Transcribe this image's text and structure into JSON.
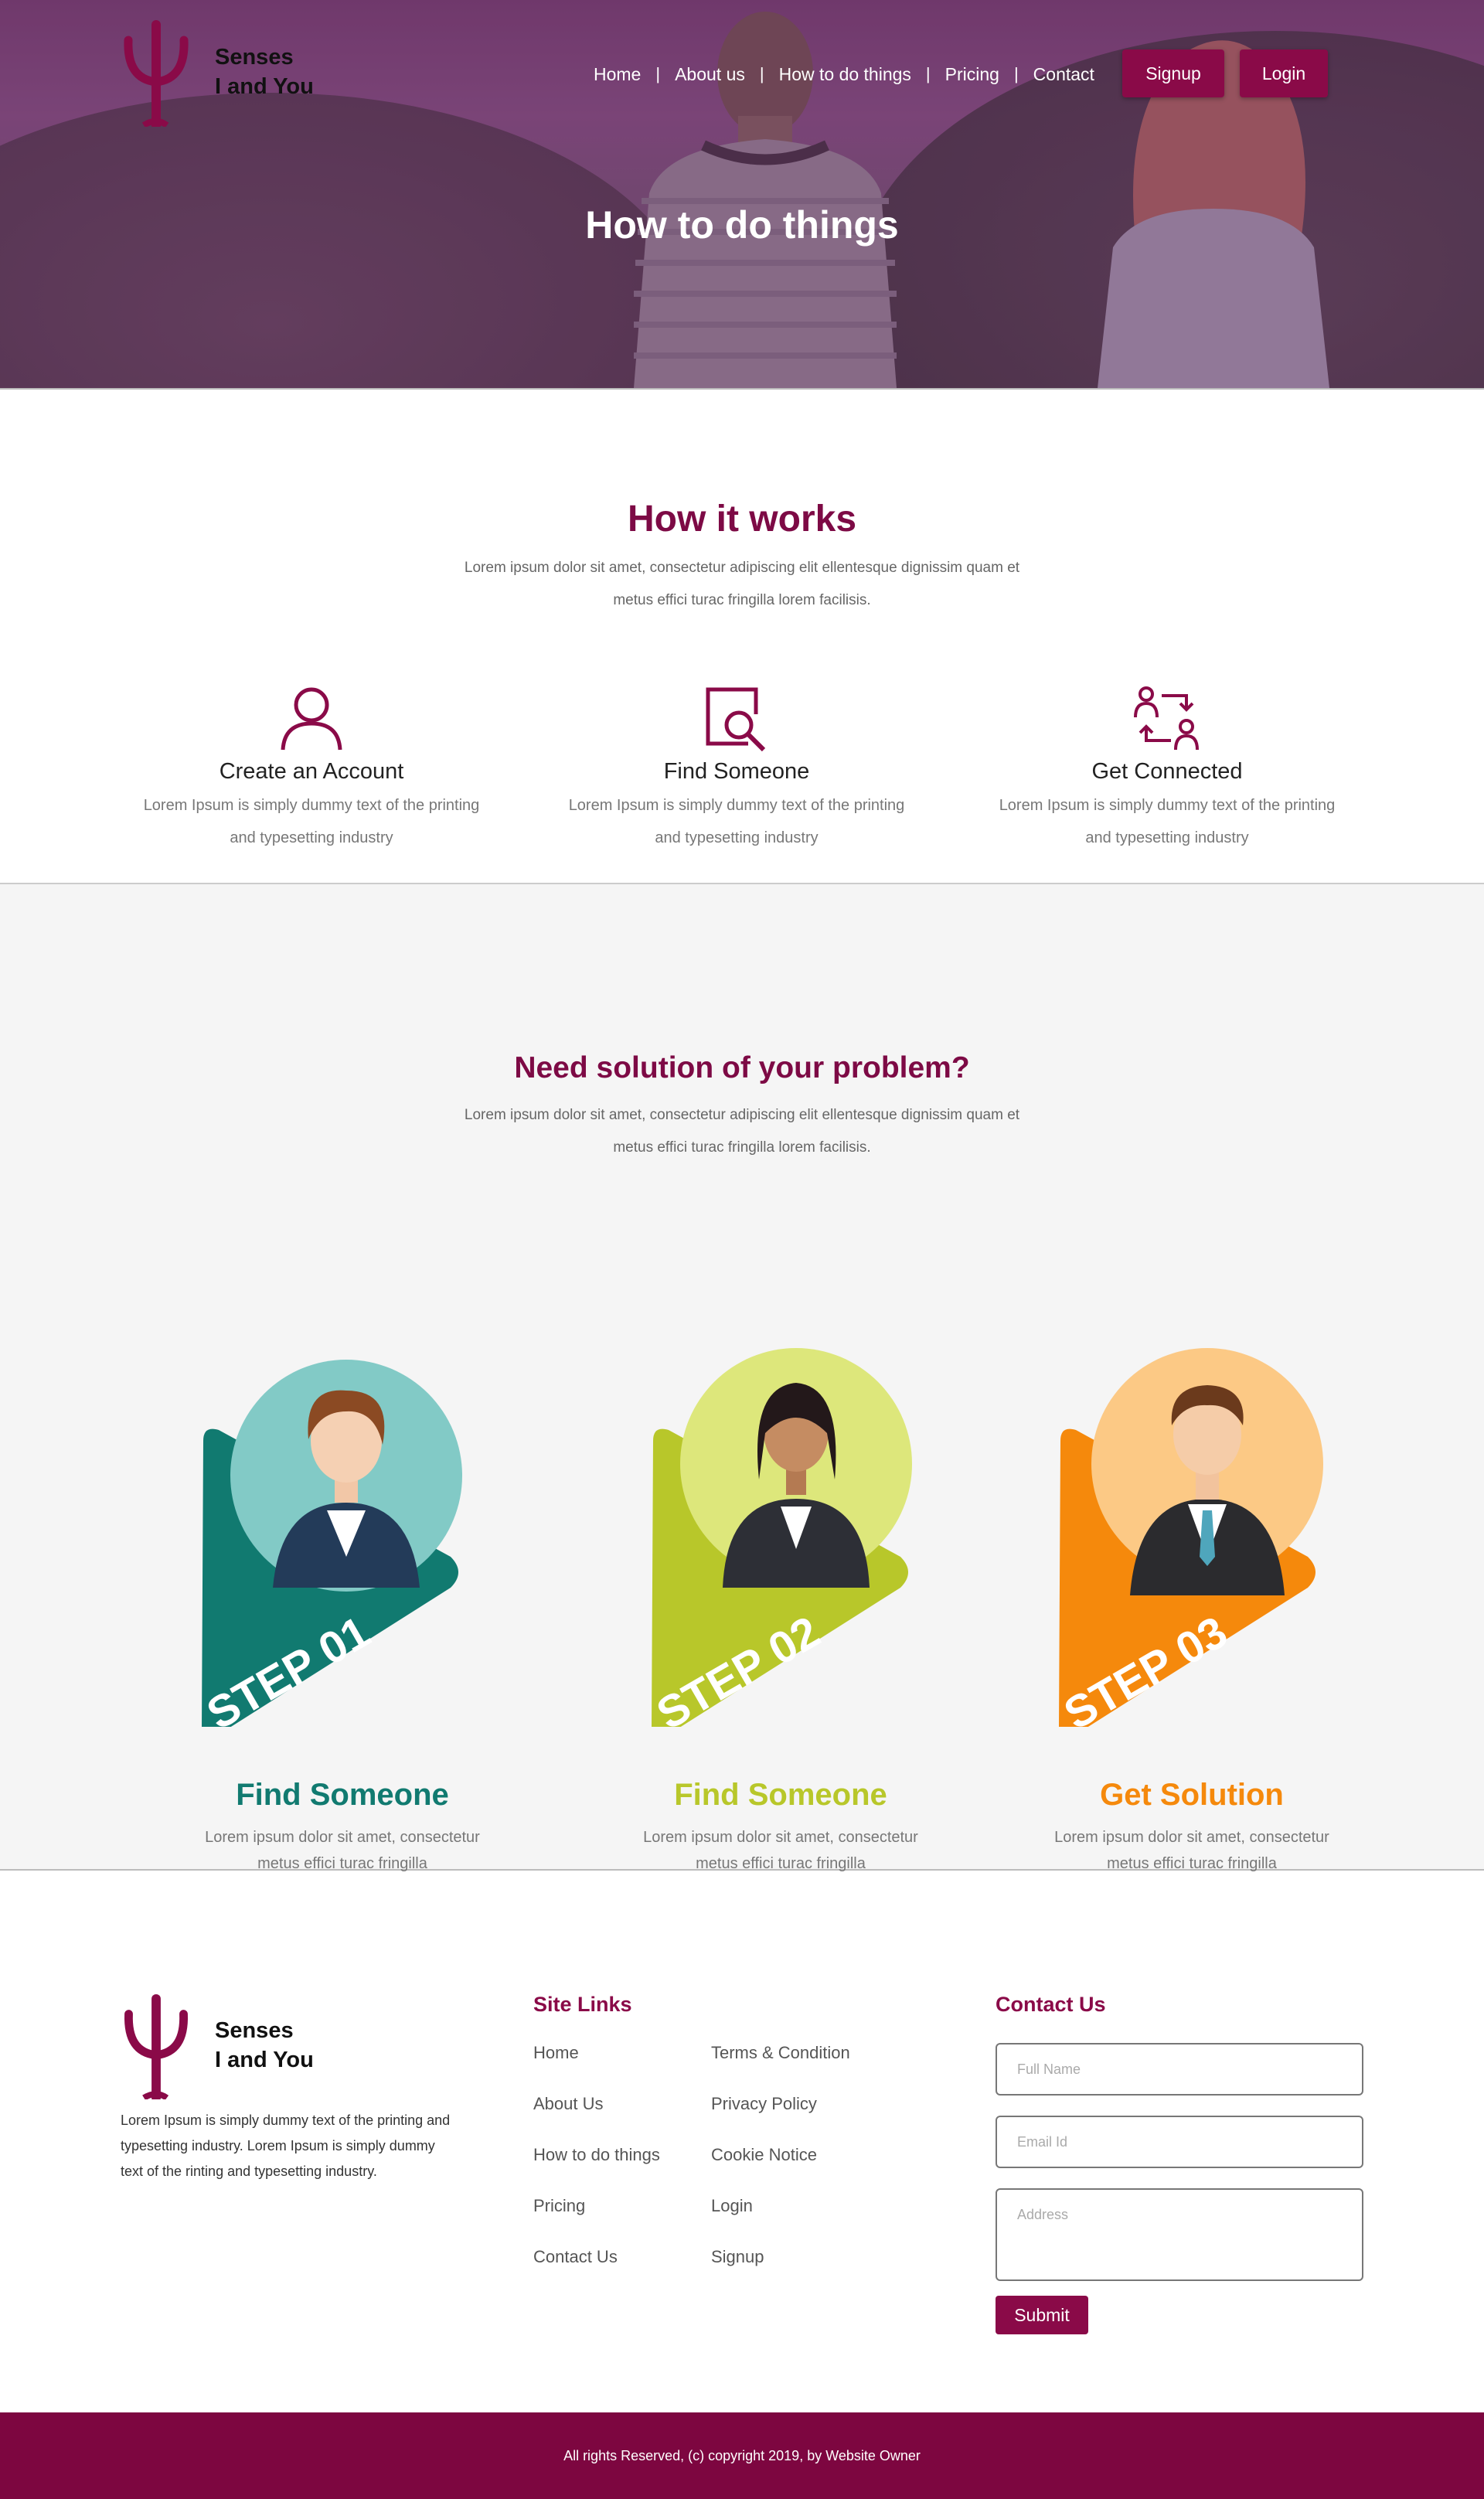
{
  "brand": {
    "line1": "Senses",
    "line2": "I and You",
    "color": "#8a0a48"
  },
  "nav": {
    "items": [
      {
        "label": "Home"
      },
      {
        "label": "About us"
      },
      {
        "label": "How to do things"
      },
      {
        "label": "Pricing"
      },
      {
        "label": "Contact"
      }
    ],
    "separator": "|",
    "signup": "Signup",
    "login": "Login"
  },
  "hero": {
    "title": "How to do things"
  },
  "how_it_works": {
    "title": "How it works",
    "subtitle_line1": "Lorem ipsum dolor sit amet, consectetur adipiscing elit ellentesque dignissim quam et",
    "subtitle_line2": "metus effici turac fringilla lorem facilisis.",
    "features": [
      {
        "icon": "user-icon",
        "title": "Create an Account",
        "desc_line1": "Lorem Ipsum is simply dummy text of the printing",
        "desc_line2": "and typesetting industry"
      },
      {
        "icon": "search-icon",
        "title": "Find Someone",
        "desc_line1": "Lorem Ipsum is simply dummy text of the printing",
        "desc_line2": "and typesetting industry"
      },
      {
        "icon": "connect-icon",
        "title": "Get Connected",
        "desc_line1": "Lorem Ipsum is simply dummy text of the printing",
        "desc_line2": "and typesetting industry"
      }
    ]
  },
  "solution": {
    "title": "Need solution of your problem?",
    "subtitle_line1": "Lorem ipsum dolor sit amet, consectetur adipiscing elit ellentesque dignissim quam et",
    "subtitle_line2": "metus effici turac fringilla lorem facilisis.",
    "steps": [
      {
        "badge": "STEP 01",
        "title": "Find Someone",
        "desc_line1": "Lorem ipsum dolor sit amet, consectetur",
        "desc_line2": "metus effici turac fringilla",
        "color": "#117a70",
        "circle": "#82cac6"
      },
      {
        "badge": "STEP 02",
        "title": "Find Someone",
        "desc_line1": "Lorem ipsum dolor sit amet, consectetur",
        "desc_line2": "metus effici turac fringilla",
        "color": "#b8c72a",
        "circle": "#dde77b"
      },
      {
        "badge": "STEP 03",
        "title": "Get Solution",
        "desc_line1": "Lorem ipsum dolor sit amet, consectetur",
        "desc_line2": "metus effici turac fringilla",
        "color": "#f5890c",
        "circle": "#fcc985"
      }
    ]
  },
  "footer": {
    "about_line1": "Lorem Ipsum is simply dummy text of the  printing and",
    "about_line2": "typesetting industry. Lorem  Ipsum is simply dummy",
    "about_line3": "text of the   rinting and typesetting industry.",
    "site_links_title": "Site Links",
    "links_col1": [
      "Home",
      "About Us",
      "How to do things",
      "Pricing",
      "Contact Us"
    ],
    "links_col2": [
      "Terms & Condition",
      "Privacy Policy",
      "Cookie Notice",
      "Login",
      "Signup"
    ],
    "contact_title": "Contact Us",
    "full_name_placeholder": "Full Name",
    "email_placeholder": "Email Id",
    "address_placeholder": "Address",
    "submit": "Submit",
    "copyright": "All rights Reserved, (c) copyright 2019, by Website Owner"
  }
}
